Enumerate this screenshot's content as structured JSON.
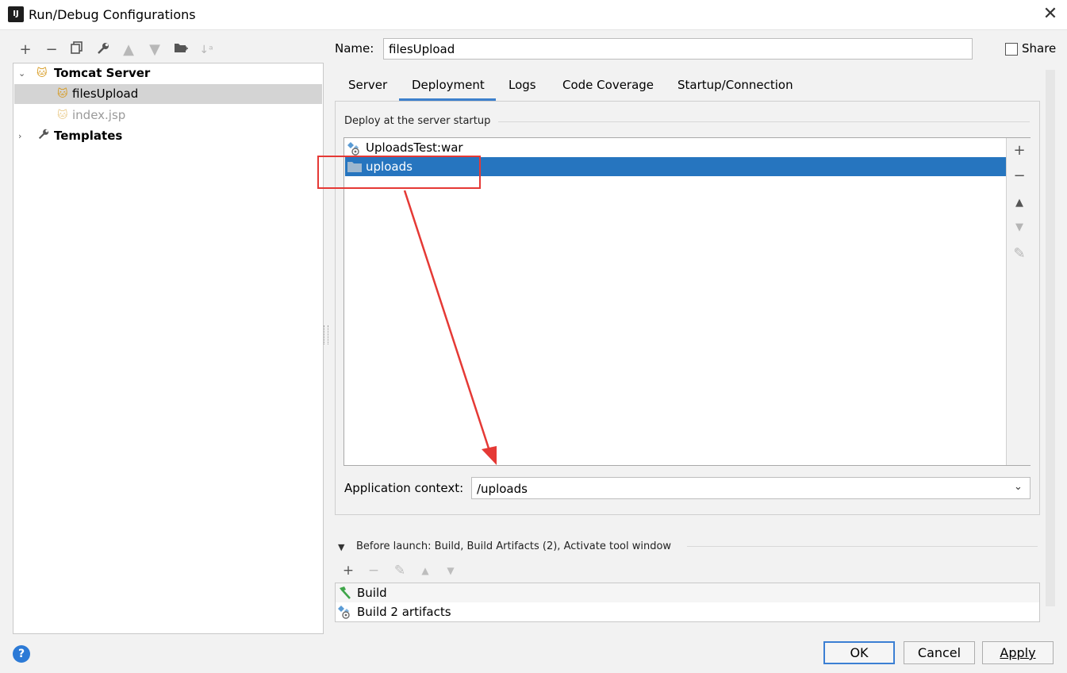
{
  "window": {
    "title": "Run/Debug Configurations",
    "app_icon": "IJ"
  },
  "toolbar": {
    "icons": [
      "add-icon",
      "remove-icon",
      "copy-icon",
      "wrench-icon",
      "move-up-icon",
      "move-down-icon",
      "new-folder-icon",
      "sort-icon"
    ]
  },
  "tree": {
    "group_label": "Tomcat Server",
    "items": [
      {
        "label": "filesUpload"
      },
      {
        "label": "index.jsp"
      }
    ],
    "templates_label": "Templates"
  },
  "name_field": {
    "label": "Name:",
    "value": "filesUpload"
  },
  "share": {
    "label": "Share",
    "checked": false
  },
  "tabs": [
    {
      "label": "Server"
    },
    {
      "label": "Deployment",
      "active": true
    },
    {
      "label": "Logs"
    },
    {
      "label": "Code Coverage"
    },
    {
      "label": "Startup/Connection"
    }
  ],
  "deployment": {
    "caption": "Deploy at the server startup",
    "items": [
      {
        "label": "UploadsTest:war",
        "icon": "artifact-icon",
        "selected": false
      },
      {
        "label": "uploads",
        "icon": "folder-icon",
        "selected": true
      }
    ],
    "context_label": "Application context:",
    "context_value": "/uploads"
  },
  "before_launch": {
    "label": "Before launch: Build, Build Artifacts (2), Activate tool window",
    "items": [
      {
        "label": "Build",
        "icon": "hammer-icon"
      },
      {
        "label": "Build 2 artifacts",
        "icon": "artifact-icon"
      }
    ]
  },
  "buttons": {
    "ok": "OK",
    "cancel": "Cancel",
    "apply": "Apply",
    "help": "?"
  },
  "colors": {
    "selection": "#2675bf",
    "accent": "#3d80cc",
    "annotation": "#e53935"
  }
}
